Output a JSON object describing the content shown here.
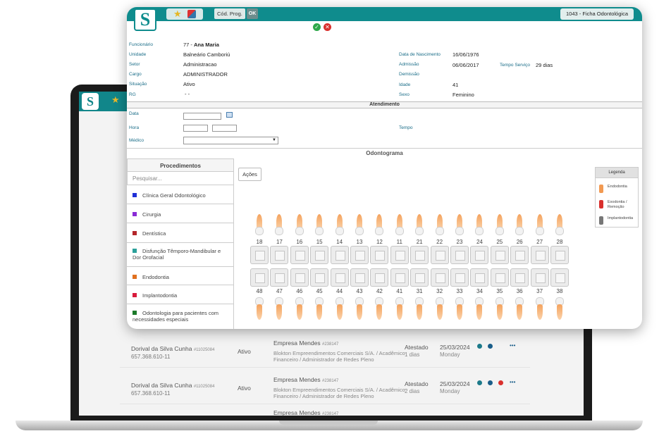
{
  "app": {
    "logo_letter": "S",
    "cod_prog_label": "Cód. Prog.",
    "ok_label": "OK",
    "page_title": "1043 - Ficha Odontológica"
  },
  "employee": {
    "labels": {
      "funcionario": "Funcionário",
      "unidade": "Unidade",
      "setor": "Setor",
      "cargo": "Cargo",
      "situacao": "Situação",
      "rg": "RG",
      "nascimento": "Data de Nascimento",
      "admissao": "Admissão",
      "tempo_servico": "Tempo Serviço",
      "demissao": "Demissão",
      "idade": "Idade",
      "sexo": "Sexo"
    },
    "id": "77 - ",
    "name": "Ana Maria",
    "unidade": "Balneário Camboriú",
    "setor": "Administracao",
    "cargo": "ADMINISTRADOR",
    "situacao": "Ativo",
    "rg": "- -",
    "nascimento": "16/06/1976",
    "admissao": "06/06/2017",
    "tempo_servico": "29 dias",
    "idade": "41",
    "sexo": "Feminino"
  },
  "atendimento": {
    "title": "Atendimento",
    "data_label": "Data",
    "hora_label": "Hora",
    "tempo_label": "Tempo",
    "medico_label": "Médico"
  },
  "odontograma": {
    "title": "Odontograma",
    "acoes_label": "Ações",
    "upper_teeth": [
      "18",
      "17",
      "16",
      "15",
      "14",
      "13",
      "12",
      "11",
      "21",
      "22",
      "23",
      "24",
      "25",
      "26",
      "27",
      "28"
    ],
    "lower_teeth": [
      "48",
      "47",
      "46",
      "45",
      "44",
      "43",
      "42",
      "41",
      "31",
      "32",
      "33",
      "34",
      "35",
      "36",
      "37",
      "38"
    ],
    "legend": {
      "title": "Legenda",
      "items": [
        {
          "label": "Endodontia",
          "color": "#f29a52"
        },
        {
          "label": "Exodontia / Remoção",
          "color": "#d9302d"
        },
        {
          "label": "Implantodontia",
          "color": "#777777"
        }
      ]
    }
  },
  "procedimentos": {
    "title": "Procedimentos",
    "search_placeholder": "Pesquisar...",
    "items": [
      {
        "label": "Clínica Geral Odontológico",
        "color": "#1f2fd6"
      },
      {
        "label": "Cirurgia",
        "color": "#8a2bd6"
      },
      {
        "label": "Dentística",
        "color": "#b3262a"
      },
      {
        "label": "Disfunção Têmporo-Mandibular e Dor Orofacial",
        "color": "#2aa09a"
      },
      {
        "label": "Endodontia",
        "color": "#e0701f"
      },
      {
        "label": "Implantodontia",
        "color": "#d81b3c"
      },
      {
        "label": "Odontologia para pacientes com necessidades especiais",
        "color": "#1c7a2a"
      }
    ]
  },
  "background_list": {
    "rows": [
      {
        "name": "Dorival da Silva Cunha",
        "id": "#11025084",
        "doc": "657.368.610-11",
        "status": "Ativo",
        "company": "Empresa Mendes",
        "company_id": "#238147",
        "description": "Blokton Empreendimentos Comerciais S/A. / Acadêmico Financeiro / Administrador de Redes Pleno",
        "type": "Atestado",
        "days": "1 dias",
        "date": "25/03/2024",
        "weekday": "Monday"
      },
      {
        "name": "Dorival da Silva Cunha",
        "id": "#11025084",
        "doc": "657.368.610-11",
        "status": "Ativo",
        "company": "Empresa Mendes",
        "company_id": "#238147",
        "description": "Blokton Empreendimentos Comerciais S/A. / Acadêmico Financeiro / Administrador de Redes Pleno",
        "type": "Atestado",
        "days": "2 dias",
        "date": "25/03/2024",
        "weekday": "Monday"
      },
      {
        "name": "",
        "id": "",
        "doc": "",
        "status": "",
        "company": "Empresa Mendes",
        "company_id": "#238147",
        "description": "",
        "type": "",
        "days": "",
        "date": "",
        "weekday": ""
      }
    ],
    "more_label": "•••"
  }
}
